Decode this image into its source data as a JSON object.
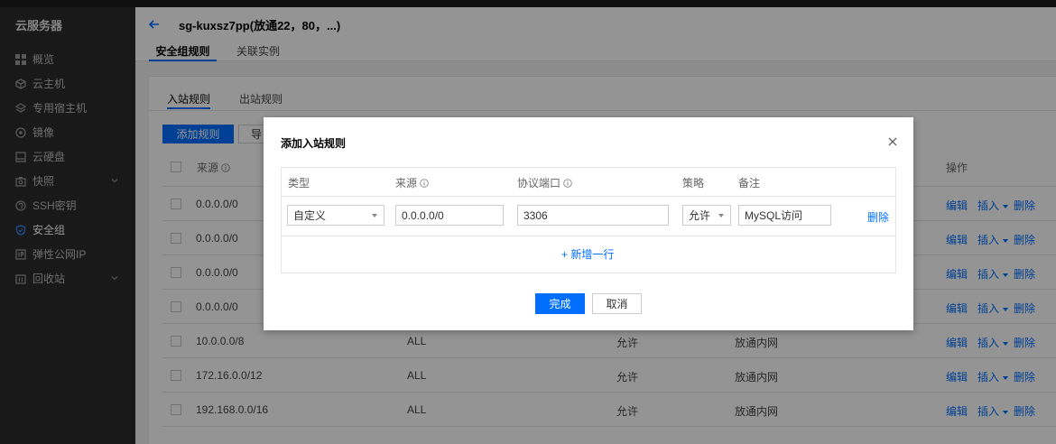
{
  "sidebar": {
    "title": "云服务器",
    "items": [
      {
        "label": "概览",
        "icon": "grid-icon"
      },
      {
        "label": "云主机",
        "icon": "cube-icon"
      },
      {
        "label": "专用宿主机",
        "icon": "layers-icon"
      },
      {
        "label": "镜像",
        "icon": "disc-icon"
      },
      {
        "label": "云硬盘",
        "icon": "harddisk-icon"
      },
      {
        "label": "快照",
        "icon": "camera-icon",
        "expandable": true
      },
      {
        "label": "SSH密钥",
        "icon": "key-icon"
      },
      {
        "label": "安全组",
        "icon": "shield-icon",
        "active": true
      },
      {
        "label": "弹性公网IP",
        "icon": "ip-icon"
      },
      {
        "label": "回收站",
        "icon": "trash-icon",
        "expandable": true
      }
    ]
  },
  "header": {
    "title": "sg-kuxsz7pp(放通22，80，...)",
    "tabs": [
      {
        "label": "安全组规则",
        "active": true
      },
      {
        "label": "关联实例",
        "active": false
      }
    ]
  },
  "card": {
    "tabs": [
      {
        "label": "入站规则",
        "active": true
      },
      {
        "label": "出站规则",
        "active": false
      }
    ],
    "add_button": "添加规则",
    "import_button": "导",
    "columns": {
      "source": "来源",
      "action": "操作"
    },
    "rows": [
      {
        "source": "0.0.0.0/0",
        "protocol": "",
        "policy": "",
        "note": ""
      },
      {
        "source": "0.0.0.0/0",
        "protocol": "",
        "policy": "",
        "note": ""
      },
      {
        "source": "0.0.0.0/0",
        "protocol": "",
        "policy": "",
        "note": ""
      },
      {
        "source": "0.0.0.0/0",
        "protocol": "",
        "policy": "",
        "note": ""
      },
      {
        "source": "10.0.0.0/8",
        "protocol": "ALL",
        "policy": "允许",
        "note": "放通内网"
      },
      {
        "source": "172.16.0.0/12",
        "protocol": "ALL",
        "policy": "允许",
        "note": "放通内网"
      },
      {
        "source": "192.168.0.0/16",
        "protocol": "ALL",
        "policy": "允许",
        "note": "放通内网"
      }
    ],
    "row_actions": {
      "edit": "编辑",
      "insert": "插入",
      "delete": "删除"
    }
  },
  "modal": {
    "title": "添加入站规则",
    "columns": {
      "type": "类型",
      "source": "来源",
      "port": "协议端口",
      "policy": "策略",
      "note": "备注"
    },
    "row": {
      "type": "自定义",
      "source": "0.0.0.0/0",
      "port": "3306",
      "policy": "允许",
      "note": "MySQL访问",
      "delete": "删除"
    },
    "add_row": "+ 新增一行",
    "ok_button": "完成",
    "cancel_button": "取消"
  },
  "colors": {
    "primary": "#006eff",
    "sidebar_bg": "#2b2b2b"
  }
}
